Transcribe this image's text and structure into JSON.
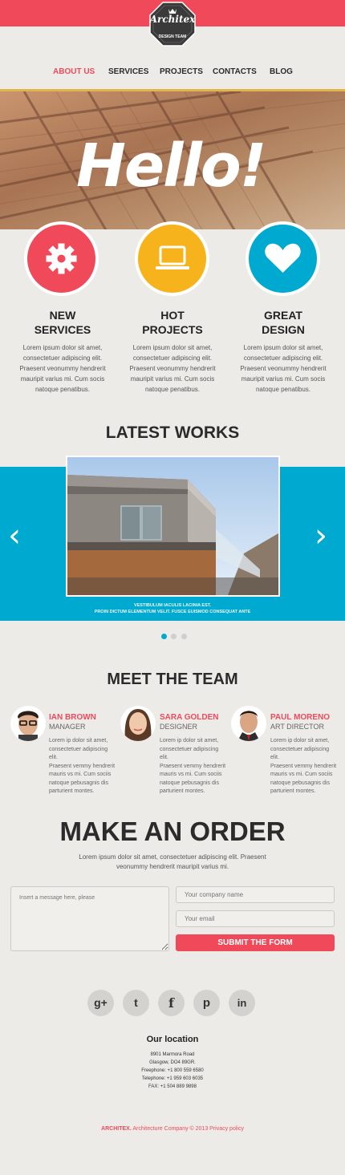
{
  "brand": {
    "name": "Architex",
    "tagline": "DESIGN TEAM",
    "accent": "#f04a5a",
    "blue": "#00a9cf",
    "yellow": "#f6b31b"
  },
  "nav": {
    "items": [
      "ABOUT US",
      "SERVICES",
      "PROJECTS",
      "CONTACTS",
      "BLOG"
    ],
    "active": "ABOUT US"
  },
  "hero": {
    "title": "Hello!"
  },
  "features": [
    {
      "icon": "gear-icon",
      "title_line1": "NEW",
      "title_line2": "SERVICES",
      "text": [
        "Lorem ipsum dolor sit amet,",
        "consectetuer adipiscing elit.",
        "Praesent veonummy hendrerit",
        "mauripit varius mi. Cum socis",
        "natoque penatibus."
      ]
    },
    {
      "icon": "laptop-icon",
      "title_line1": "HOT",
      "title_line2": "PROJECTS",
      "text": [
        "Lorem ipsum dolor sit amet,",
        "consectetuer adipiscing elit.",
        "Praesent veonummy hendrerit",
        "mauripit varius mi. Cum socis",
        "natoque penatibus."
      ]
    },
    {
      "icon": "heart-icon",
      "title_line1": "GREAT",
      "title_line2": "DESIGN",
      "text": [
        "Lorem ipsum dolor sit amet,",
        "consectetuer adipiscing elit.",
        "Praesent veonummy hendrerit",
        "mauripit varius mi. Cum socis",
        "natoque penatibus."
      ]
    }
  ],
  "works": {
    "title": "LATEST WORKS",
    "caption_line1": "VESTIBULUM IACULIS LACINIA EST.",
    "caption_line2": "PROIN DICTUM ELEMENTUM VELIT. FUSCE EUISMOD CONSEQUAT ANTE",
    "prev": "‹",
    "next": "›"
  },
  "team": {
    "title": "MEET THE TEAM",
    "members": [
      {
        "name": "IAN BROWN",
        "role": "MANAGER",
        "text": [
          "Lorem ip dolor sit amet,",
          "consectetuer adipiscing elit.",
          "Praesent vemmy hendrerit",
          "mauris vs mi. Cum sociis",
          "natoque pebusagnis dis",
          "parturient montes."
        ]
      },
      {
        "name": "SARA GOLDEN",
        "role": "DESIGNER",
        "text": [
          "Lorem ip dolor sit amet,",
          "consectetuer adipiscing elit.",
          "Praesent vemmy hendrerit",
          "mauris vs mi. Cum sociis",
          "natoque pebusagnis dis",
          "parturient montes."
        ]
      },
      {
        "name": "PAUL MORENO",
        "role": "ART DIRECTOR",
        "text": [
          "Lorem ip dolor sit amet,",
          "consectetuer adipiscing elit.",
          "Praesent vemmy hendrerit",
          "mauris vs mi. Cum sociis",
          "natoque pebusagnis dis",
          "parturient montes."
        ]
      }
    ]
  },
  "order": {
    "title": "MAKE AN ORDER",
    "text_line1": "Lorem ipsum dolor sit amet, consectetuer adipiscing elit. Praesent",
    "text_line2": "veonummy hendrerit mauripit varius mi.",
    "message_placeholder": "Insert a message here, please",
    "company_placeholder": "Your company name",
    "email_placeholder": "Your email",
    "submit_label": "SUBMIT THE FORM"
  },
  "social": [
    "g+",
    "t",
    "f",
    "p",
    "in"
  ],
  "location": {
    "title": "Our location",
    "lines": [
      "8901 Marmora Road",
      "Glasgow, DO4 89GR.",
      "Freephone:  +1 800 559 6580",
      "Telephone:  +1 959 603 6035",
      "FAX:           +1 504 889 9898"
    ]
  },
  "footer": {
    "brand": "ARCHITEX.",
    "text": " Architecture Company © 2013 Privacy policy"
  }
}
